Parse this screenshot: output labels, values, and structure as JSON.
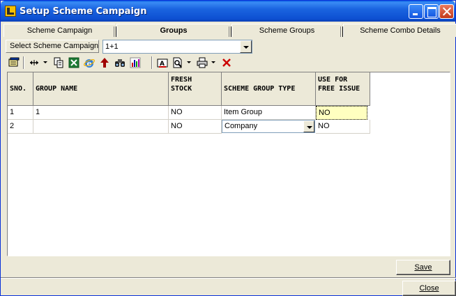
{
  "window": {
    "title": "Setup Scheme Campaign"
  },
  "tabs": [
    {
      "label": "Scheme Campaign",
      "active": false
    },
    {
      "label": "Groups",
      "active": true
    },
    {
      "label": "Scheme Groups",
      "active": false
    },
    {
      "label": "Scheme Combo Details",
      "active": false
    }
  ],
  "campaign": {
    "label": "Select Scheme Campaign",
    "value": "1+1"
  },
  "toolbar": {
    "icons": [
      "window-icon",
      "column-resize-icon",
      "copy-icon",
      "excel-icon",
      "ie-icon",
      "up-arrow-icon",
      "binoculars-icon",
      "chart-icon",
      "font-icon",
      "print-preview-icon",
      "print-icon",
      "delete-icon"
    ]
  },
  "grid": {
    "headers": {
      "sno": "SNO.",
      "group_name": "GROUP NAME",
      "fresh_stock_1": "FRESH",
      "fresh_stock_2": "STOCK",
      "scheme_group_type": "SCHEME GROUP TYPE",
      "use_free_1": "USE FOR",
      "use_free_2": "FREE ISSUE"
    },
    "rows": [
      {
        "sno": "1",
        "group_name": "1",
        "fresh_stock": "NO",
        "scheme_group_type": "Item Group",
        "use_for_free_issue": "NO"
      },
      {
        "sno": "2",
        "group_name": "",
        "fresh_stock": "NO",
        "scheme_group_type": "Company",
        "use_for_free_issue": "NO"
      }
    ]
  },
  "buttons": {
    "save": "Save",
    "close": "Close"
  },
  "colors": {
    "titlebar": "#0a5fe3",
    "highlight_cell": "#ffffc0",
    "delete": "#cc0000"
  }
}
